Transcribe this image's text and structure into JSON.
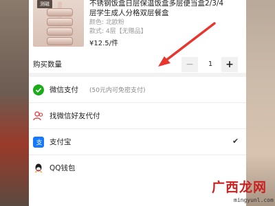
{
  "product": {
    "thumb_tag": "测磁",
    "title_line1": "不锈钢饭盒日层保温饭盒多层便当盒2/3/4",
    "title_line2": "层学生成人分格双层餐盒",
    "color_spec": "颜色: 北欧粉",
    "style_spec": "款式: 4层【无赠品】",
    "price": "¥12.5/件"
  },
  "quantity": {
    "label": "购买数量",
    "minus": "−",
    "value": "1",
    "plus": "+"
  },
  "payment": {
    "items": [
      {
        "label": "微信支付",
        "note": "(50元内可免密支付)",
        "icon": "wechat-pay-icon",
        "color": "#1aad19"
      },
      {
        "label": "找微信好友代付",
        "note": "",
        "icon": "friend-pay-icon",
        "color": "#e04848"
      },
      {
        "label": "支付宝",
        "note": "",
        "icon": "alipay-icon",
        "color": "#1677ff",
        "selected": true
      },
      {
        "label": "QQ钱包",
        "note": "",
        "icon": "qq-wallet-icon",
        "color": "#1a1a1a"
      }
    ],
    "check_mark": "✔"
  },
  "watermark": {
    "logo": "广西龙网",
    "url": "mingyunl.com"
  }
}
